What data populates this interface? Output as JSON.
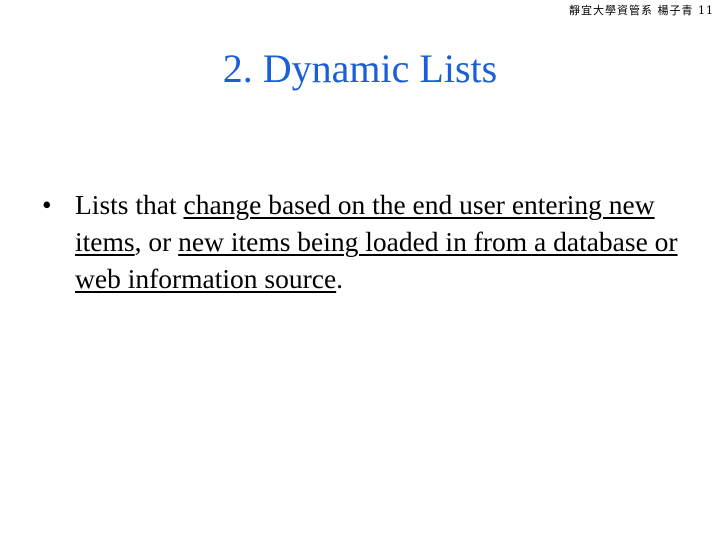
{
  "header": {
    "note": "靜宜大學資管系 楊子青",
    "page_number": "11"
  },
  "slide": {
    "title": "2. Dynamic Lists",
    "title_color": "#1a5fd6",
    "bullets": [
      {
        "marker": "•",
        "segments": [
          {
            "text": "Lists that ",
            "underline": false
          },
          {
            "text": "change based on the end user entering new items",
            "underline": true
          },
          {
            "text": ", or ",
            "underline": false
          },
          {
            "text": "new items being loaded in from a database or web information source",
            "underline": true
          },
          {
            "text": ".",
            "underline": false
          }
        ]
      }
    ]
  }
}
